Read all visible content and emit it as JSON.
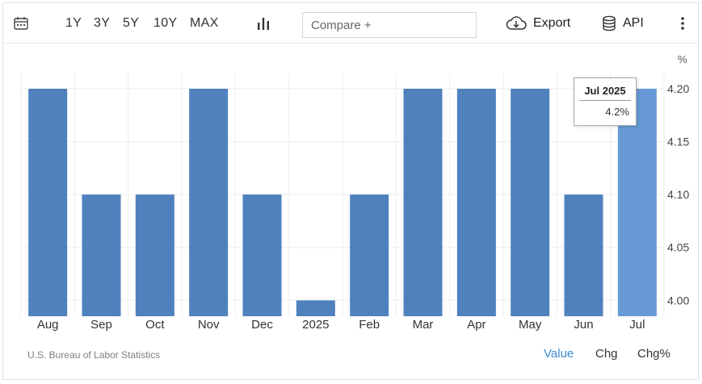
{
  "toolbar": {
    "calendar_icon": "calendar-icon",
    "ranges": [
      "1Y",
      "3Y",
      "5Y",
      "10Y",
      "MAX"
    ],
    "chart_type_icon": "bar-chart-icon",
    "compare_placeholder": "Compare +",
    "export_label": "Export",
    "export_icon": "cloud-download-icon",
    "api_label": "API",
    "api_icon": "database-icon",
    "more_icon": "vertical-dots-icon"
  },
  "unit_label": "%",
  "tooltip": {
    "title": "Jul 2025",
    "value": "4.2%"
  },
  "source": "U.S. Bureau of Labor Statistics",
  "view_toggles": [
    "Value",
    "Chg",
    "Chg%"
  ],
  "active_toggle": "Value",
  "colors": {
    "bar": "#4f81bd",
    "bar_highlight": "#6699d6",
    "accent": "#3e8ed0"
  },
  "chart_data": {
    "type": "bar",
    "categories": [
      "Aug",
      "Sep",
      "Oct",
      "Nov",
      "Dec",
      "2025",
      "Feb",
      "Mar",
      "Apr",
      "May",
      "Jun",
      "Jul"
    ],
    "values": [
      4.2,
      4.1,
      4.1,
      4.2,
      4.1,
      4.0,
      4.1,
      4.2,
      4.2,
      4.2,
      4.1,
      4.2
    ],
    "highlighted_category": "Jul",
    "y_ticks": [
      "4.20",
      "4.15",
      "4.10",
      "4.05",
      "4.00"
    ],
    "ylim": [
      3.985,
      4.2
    ],
    "y_axis_side": "right",
    "grid": true
  }
}
